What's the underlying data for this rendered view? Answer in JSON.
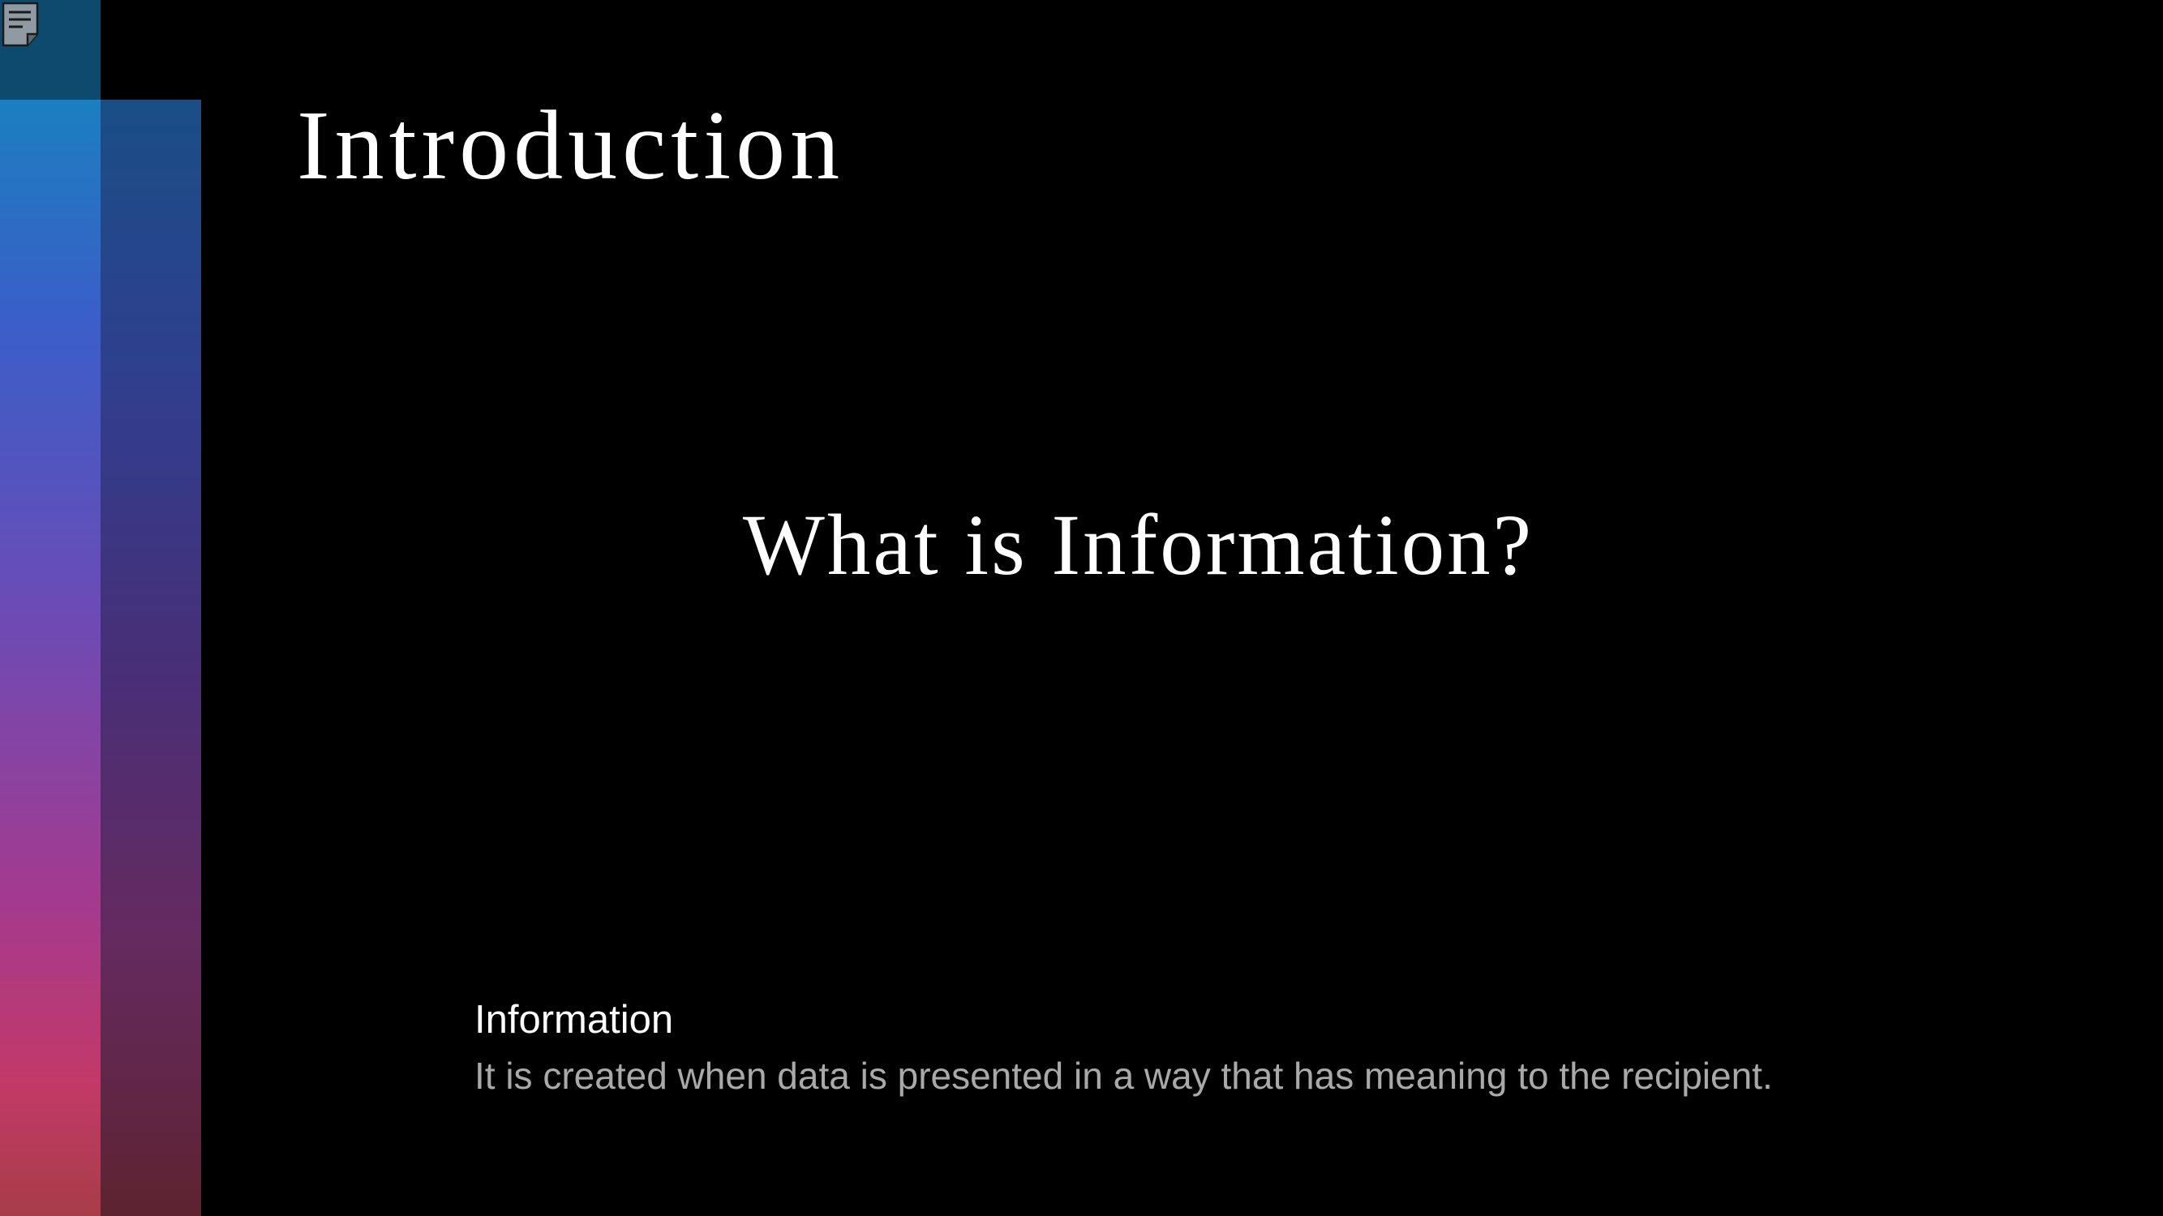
{
  "slide": {
    "title": "Introduction",
    "question": "What is Information?",
    "term": "Information",
    "definition": "It is created when data is presented in a way that has meaning to the recipient."
  },
  "icons": {
    "notes": "notes-document-icon"
  },
  "colors": {
    "background": "#000000",
    "corner_block": "#0e4a6e",
    "title_text": "#ffffff",
    "definition_text": "#a9a9a9",
    "gradient_top": "#1b7fc0",
    "gradient_mid": "#6a4cb6",
    "gradient_bottom": "#c33968"
  }
}
